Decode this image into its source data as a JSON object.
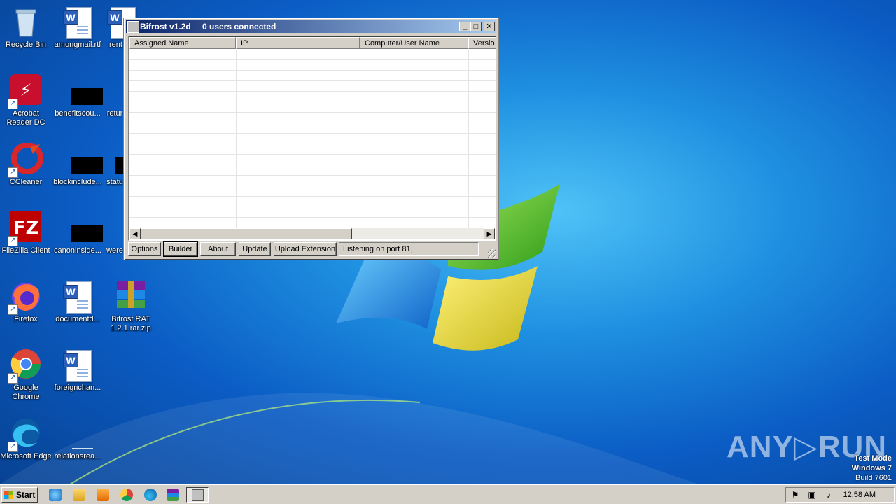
{
  "desktop": {
    "icons": [
      {
        "label": "Recycle Bin"
      },
      {
        "label": "amongmail.rtf"
      },
      {
        "label": "rent..."
      },
      {
        "label": "Acrobat Reader DC"
      },
      {
        "label": "benefitscou..."
      },
      {
        "label": "retur"
      },
      {
        "label": "CCleaner"
      },
      {
        "label": "blockinclude..."
      },
      {
        "label": "statu"
      },
      {
        "label": "FileZilla Client"
      },
      {
        "label": "canoninside..."
      },
      {
        "label": "were"
      },
      {
        "label": "Firefox"
      },
      {
        "label": "documentd..."
      },
      {
        "label": "Bifrost RAT 1.2.1.rar.zip"
      },
      {
        "label": "Google Chrome"
      },
      {
        "label": "foreignchan..."
      },
      {
        "label": "Microsoft Edge"
      },
      {
        "label": "relationsrea..."
      }
    ]
  },
  "window": {
    "title": "Bifrost v1.2d",
    "subtitle": "0 users connected",
    "columns": [
      "Assigned Name",
      "IP",
      "Computer/User Name",
      "Versio"
    ],
    "buttons": [
      "Options",
      "Builder",
      "About",
      "Update",
      "Upload Extension"
    ],
    "status": "Listening on port 81,",
    "title_buttons": {
      "minimize": "_",
      "maximize": "□",
      "close": "✕"
    }
  },
  "watermark": {
    "brand": "ANY▷RUN",
    "line1": "Test Mode",
    "line2": "Windows 7",
    "line3": "Build 7601"
  },
  "taskbar": {
    "start_label": "Start",
    "clock": "12:58 AM"
  },
  "colors": {
    "titlebar_start": "#0a246a",
    "titlebar_end": "#a6caf0",
    "face": "#d4d0c8"
  }
}
